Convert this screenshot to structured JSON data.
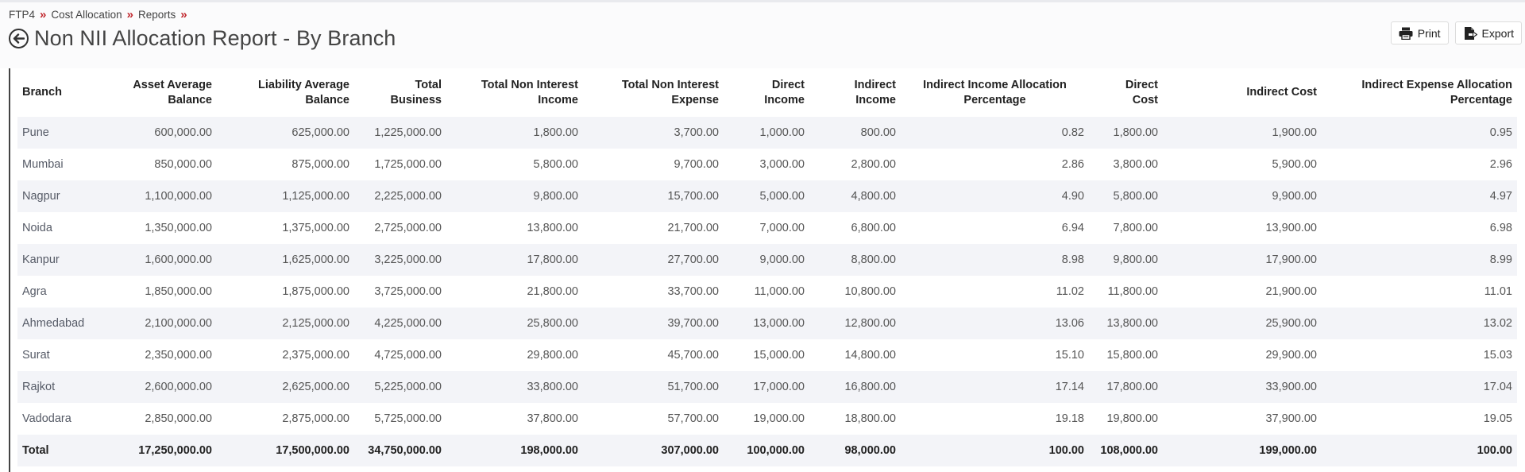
{
  "breadcrumb": [
    "FTP4",
    "Cost Allocation",
    "Reports"
  ],
  "breadcrumb_separator": "»",
  "page_title": "Non NII Allocation Report - By Branch",
  "toolbar": {
    "print_label": "Print",
    "export_label": "Export"
  },
  "table": {
    "columns": [
      {
        "line1": "Branch",
        "line2": ""
      },
      {
        "line1": "Asset Average",
        "line2": "Balance"
      },
      {
        "line1": "Liability Average",
        "line2": "Balance"
      },
      {
        "line1": "Total",
        "line2": "Business"
      },
      {
        "line1": "Total Non Interest",
        "line2": "Income"
      },
      {
        "line1": "Total Non Interest",
        "line2": "Expense"
      },
      {
        "line1": "Direct",
        "line2": "Income"
      },
      {
        "line1": "Indirect",
        "line2": "Income"
      },
      {
        "line1": "Indirect Income Allocation",
        "line2": "Percentage"
      },
      {
        "line1": "Direct",
        "line2": "Cost"
      },
      {
        "line1": "Indirect Cost",
        "line2": ""
      },
      {
        "line1": "Indirect Expense Allocation",
        "line2": "Percentage"
      }
    ],
    "rows": [
      [
        "Pune",
        "600,000.00",
        "625,000.00",
        "1,225,000.00",
        "1,800.00",
        "3,700.00",
        "1,000.00",
        "800.00",
        "0.82",
        "1,800.00",
        "1,900.00",
        "0.95"
      ],
      [
        "Mumbai",
        "850,000.00",
        "875,000.00",
        "1,725,000.00",
        "5,800.00",
        "9,700.00",
        "3,000.00",
        "2,800.00",
        "2.86",
        "3,800.00",
        "5,900.00",
        "2.96"
      ],
      [
        "Nagpur",
        "1,100,000.00",
        "1,125,000.00",
        "2,225,000.00",
        "9,800.00",
        "15,700.00",
        "5,000.00",
        "4,800.00",
        "4.90",
        "5,800.00",
        "9,900.00",
        "4.97"
      ],
      [
        "Noida",
        "1,350,000.00",
        "1,375,000.00",
        "2,725,000.00",
        "13,800.00",
        "21,700.00",
        "7,000.00",
        "6,800.00",
        "6.94",
        "7,800.00",
        "13,900.00",
        "6.98"
      ],
      [
        "Kanpur",
        "1,600,000.00",
        "1,625,000.00",
        "3,225,000.00",
        "17,800.00",
        "27,700.00",
        "9,000.00",
        "8,800.00",
        "8.98",
        "9,800.00",
        "17,900.00",
        "8.99"
      ],
      [
        "Agra",
        "1,850,000.00",
        "1,875,000.00",
        "3,725,000.00",
        "21,800.00",
        "33,700.00",
        "11,000.00",
        "10,800.00",
        "11.02",
        "11,800.00",
        "21,900.00",
        "11.01"
      ],
      [
        "Ahmedabad",
        "2,100,000.00",
        "2,125,000.00",
        "4,225,000.00",
        "25,800.00",
        "39,700.00",
        "13,000.00",
        "12,800.00",
        "13.06",
        "13,800.00",
        "25,900.00",
        "13.02"
      ],
      [
        "Surat",
        "2,350,000.00",
        "2,375,000.00",
        "4,725,000.00",
        "29,800.00",
        "45,700.00",
        "15,000.00",
        "14,800.00",
        "15.10",
        "15,800.00",
        "29,900.00",
        "15.03"
      ],
      [
        "Rajkot",
        "2,600,000.00",
        "2,625,000.00",
        "5,225,000.00",
        "33,800.00",
        "51,700.00",
        "17,000.00",
        "16,800.00",
        "17.14",
        "17,800.00",
        "33,900.00",
        "17.04"
      ],
      [
        "Vadodara",
        "2,850,000.00",
        "2,875,000.00",
        "5,725,000.00",
        "37,800.00",
        "57,700.00",
        "19,000.00",
        "18,800.00",
        "19.18",
        "19,800.00",
        "37,900.00",
        "19.05"
      ]
    ],
    "total_row": [
      "Total",
      "17,250,000.00",
      "17,500,000.00",
      "34,750,000.00",
      "198,000.00",
      "307,000.00",
      "100,000.00",
      "98,000.00",
      "100.00",
      "108,000.00",
      "199,000.00",
      "100.00"
    ]
  },
  "colors": {
    "accent_separator": "#c1272d",
    "row_stripe": "#f3f4f8"
  },
  "icons": {
    "back": "circle-arrow-left-icon",
    "print": "printer-icon",
    "export": "export-file-icon"
  }
}
